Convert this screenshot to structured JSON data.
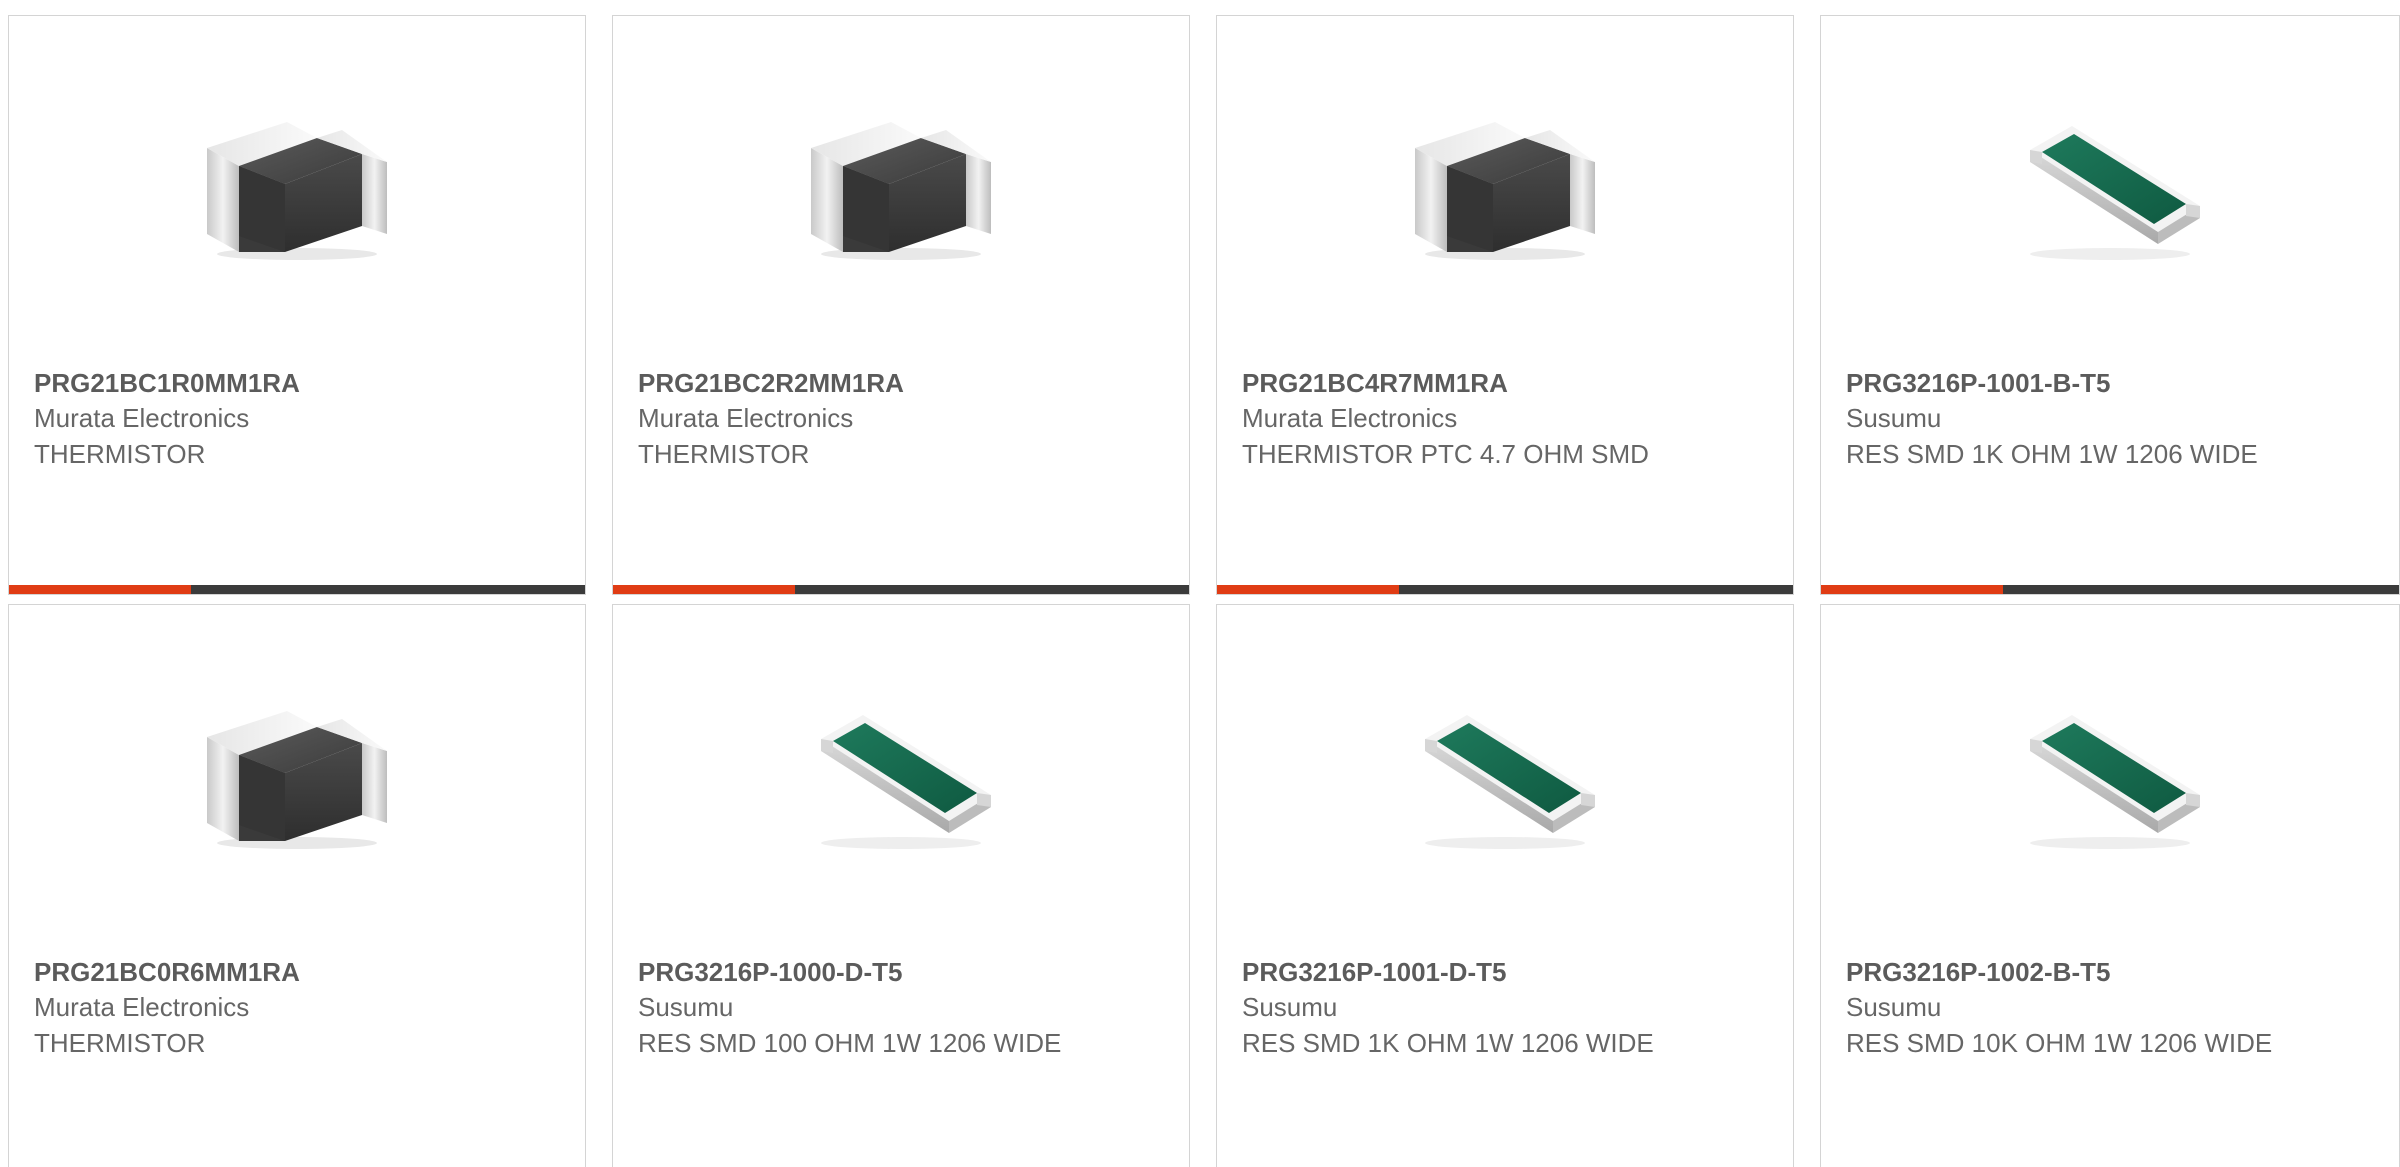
{
  "colors": {
    "accent": "#e03c14",
    "bar": "#3b3b3b",
    "border": "#d4d4d4",
    "part_text": "#5b5b5b",
    "body_text": "#666666"
  },
  "products": [
    {
      "part_number": "PRG21BC1R0MM1RA",
      "manufacturer": "Murata Electronics",
      "description": "THERMISTOR",
      "icon": "thermistor-chip-icon"
    },
    {
      "part_number": "PRG21BC2R2MM1RA",
      "manufacturer": "Murata Electronics",
      "description": "THERMISTOR",
      "icon": "thermistor-chip-icon"
    },
    {
      "part_number": "PRG21BC4R7MM1RA",
      "manufacturer": "Murata Electronics",
      "description": "THERMISTOR PTC 4.7 OHM SMD",
      "icon": "thermistor-chip-icon"
    },
    {
      "part_number": "PRG3216P-1001-B-T5",
      "manufacturer": "Susumu",
      "description": "RES SMD 1K OHM 1W 1206 WIDE",
      "icon": "resistor-chip-icon"
    },
    {
      "part_number": "PRG21BC0R6MM1RA",
      "manufacturer": "Murata Electronics",
      "description": "THERMISTOR",
      "icon": "thermistor-chip-icon"
    },
    {
      "part_number": "PRG3216P-1000-D-T5",
      "manufacturer": "Susumu",
      "description": "RES SMD 100 OHM 1W 1206 WIDE",
      "icon": "resistor-chip-icon"
    },
    {
      "part_number": "PRG3216P-1001-D-T5",
      "manufacturer": "Susumu",
      "description": "RES SMD 1K OHM 1W 1206 WIDE",
      "icon": "resistor-chip-icon"
    },
    {
      "part_number": "PRG3216P-1002-B-T5",
      "manufacturer": "Susumu",
      "description": "RES SMD 10K OHM 1W 1206 WIDE",
      "icon": "resistor-chip-icon"
    }
  ]
}
